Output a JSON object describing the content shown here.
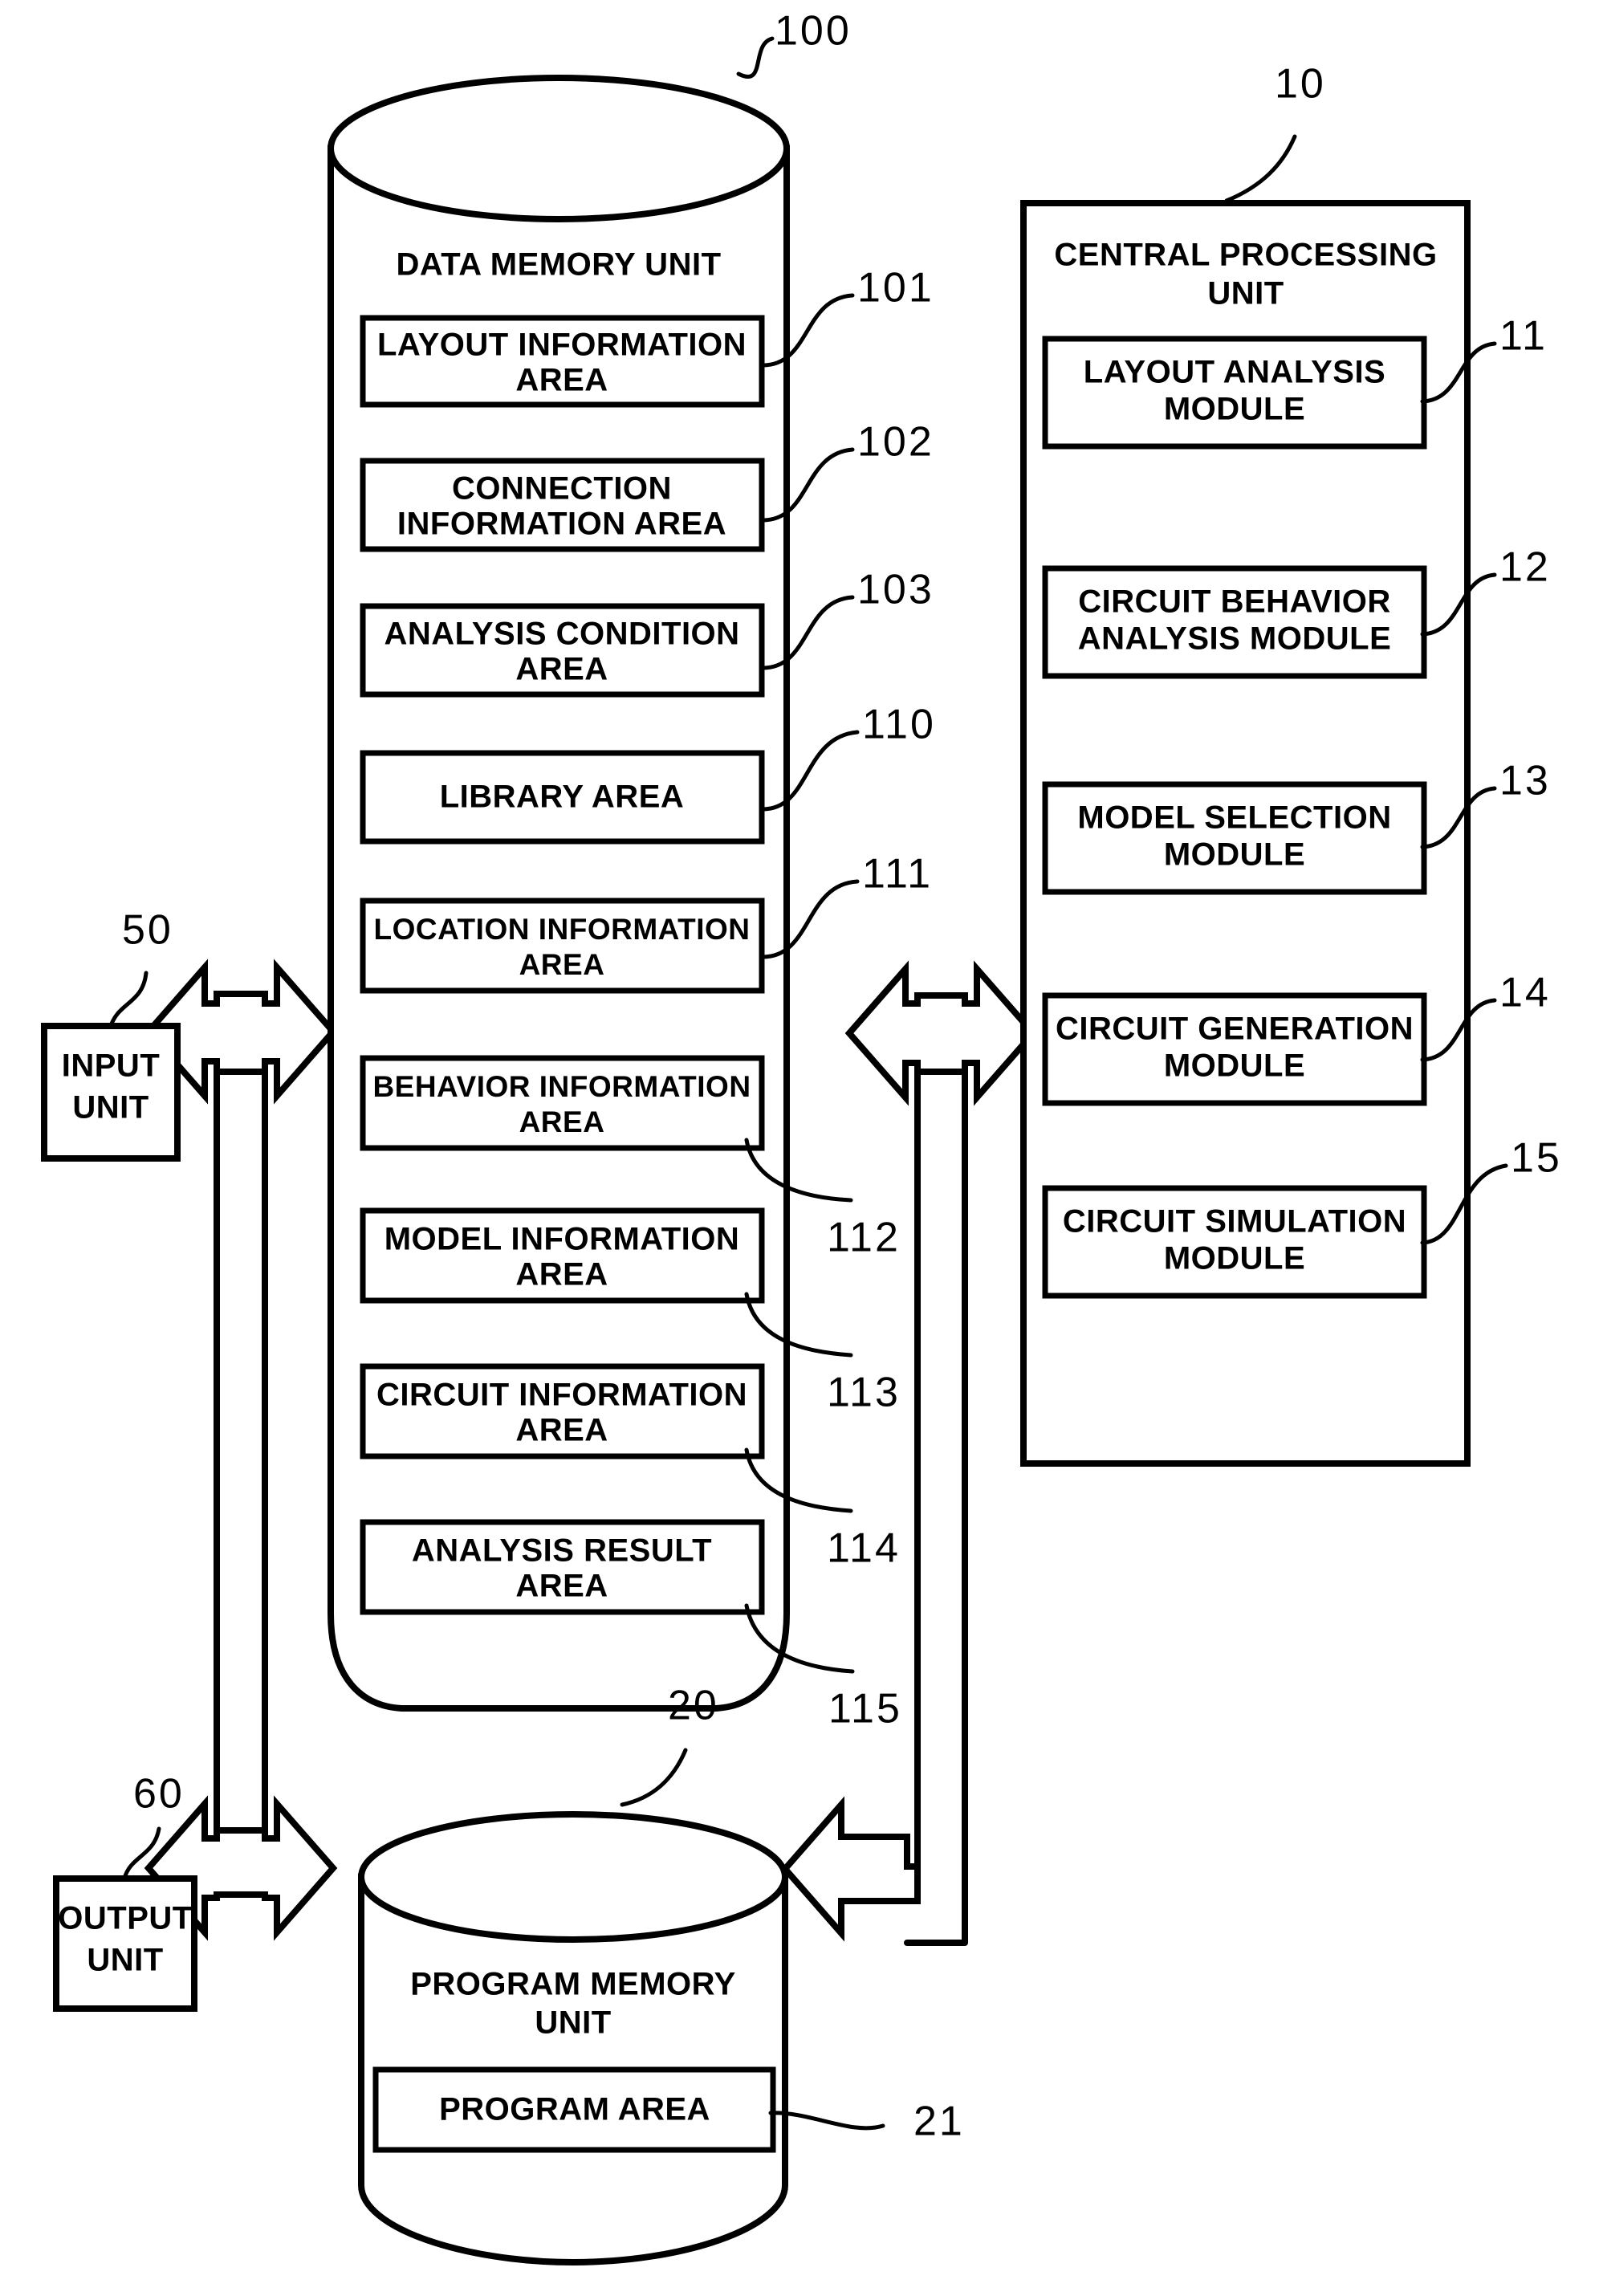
{
  "figure": {
    "type": "patent-block-diagram",
    "background_color": "#ffffff",
    "line_color": "#000000"
  },
  "data_memory_unit": {
    "title_line1": "DATA MEMORY UNIT",
    "ref": "100",
    "areas": [
      {
        "line1": "LAYOUT INFORMATION",
        "line2": "AREA",
        "ref": "101"
      },
      {
        "line1": "CONNECTION",
        "line2": "INFORMATION AREA",
        "ref": "102"
      },
      {
        "line1": "ANALYSIS CONDITION",
        "line2": "AREA",
        "ref": "103"
      },
      {
        "line1": "LIBRARY AREA",
        "line2": "",
        "ref": "110"
      },
      {
        "line1": "LOCATION INFORMATION",
        "line2": "AREA",
        "ref": "111"
      },
      {
        "line1": "BEHAVIOR INFORMATION",
        "line2": "AREA",
        "ref": "112"
      },
      {
        "line1": "MODEL INFORMATION",
        "line2": "AREA",
        "ref": "113"
      },
      {
        "line1": "CIRCUIT INFORMATION",
        "line2": "AREA",
        "ref": "114"
      },
      {
        "line1": "ANALYSIS RESULT",
        "line2": "AREA",
        "ref": "115"
      }
    ]
  },
  "central_processing_unit": {
    "title_line1": "CENTRAL PROCESSING",
    "title_line2": "UNIT",
    "ref": "10",
    "modules": [
      {
        "line1": "LAYOUT ANALYSIS",
        "line2": "MODULE",
        "ref": "11"
      },
      {
        "line1": "CIRCUIT BEHAVIOR",
        "line2": "ANALYSIS MODULE",
        "ref": "12"
      },
      {
        "line1": "MODEL SELECTION",
        "line2": "MODULE",
        "ref": "13"
      },
      {
        "line1": "CIRCUIT GENERATION",
        "line2": "MODULE",
        "ref": "14"
      },
      {
        "line1": "CIRCUIT SIMULATION",
        "line2": "MODULE",
        "ref": "15"
      }
    ]
  },
  "program_memory_unit": {
    "title_line1": "PROGRAM MEMORY",
    "title_line2": "UNIT",
    "ref": "20",
    "areas": [
      {
        "line1": "PROGRAM AREA",
        "line2": "",
        "ref": "21"
      }
    ]
  },
  "input_unit": {
    "line1": "INPUT",
    "line2": "UNIT",
    "ref": "50"
  },
  "output_unit": {
    "line1": "OUTPUT",
    "line2": "UNIT",
    "ref": "60"
  },
  "connectors": [
    {
      "name": "left-bus",
      "kind": "bidirectional-vertical-bus"
    },
    {
      "name": "right-bus",
      "kind": "bidirectional-vertical-bus"
    }
  ]
}
